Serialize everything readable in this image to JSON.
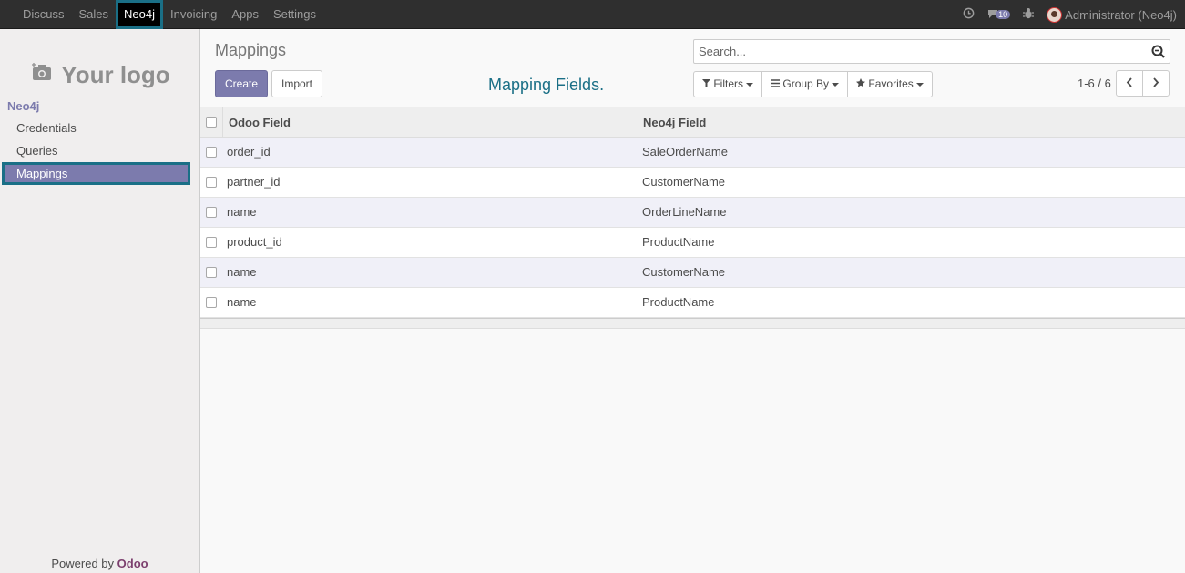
{
  "topnav": {
    "items": [
      {
        "label": "Discuss",
        "active": false
      },
      {
        "label": "Sales",
        "active": false
      },
      {
        "label": "Neo4j",
        "active": true
      },
      {
        "label": "Invoicing",
        "active": false
      },
      {
        "label": "Apps",
        "active": false
      },
      {
        "label": "Settings",
        "active": false
      }
    ],
    "messages_count": "10",
    "user": "Administrator (Neo4j)"
  },
  "sidebar": {
    "logo_text": "Your logo",
    "section": "Neo4j",
    "items": [
      {
        "label": "Credentials",
        "active": false
      },
      {
        "label": "Queries",
        "active": false
      },
      {
        "label": "Mappings",
        "active": true
      }
    ],
    "powered_by": "Powered by",
    "powered_brand": "Odoo"
  },
  "main": {
    "breadcrumb": "Mappings",
    "create_label": "Create",
    "import_label": "Import",
    "list_title": "Mapping Fields.",
    "search_placeholder": "Search...",
    "filters_label": "Filters",
    "groupby_label": "Group By",
    "favorites_label": "Favorites",
    "pager": "1-6 / 6"
  },
  "table": {
    "columns": [
      "Odoo Field",
      "Neo4j Field"
    ],
    "rows": [
      [
        "order_id",
        "SaleOrderName"
      ],
      [
        "partner_id",
        "CustomerName"
      ],
      [
        "name",
        "OrderLineName"
      ],
      [
        "product_id",
        "ProductName"
      ],
      [
        "name",
        "CustomerName"
      ],
      [
        "name",
        "ProductName"
      ]
    ]
  },
  "colors": {
    "accent": "#7c7bad",
    "highlight_outline": "#1a6f86",
    "topbar": "#2f2f2f"
  }
}
